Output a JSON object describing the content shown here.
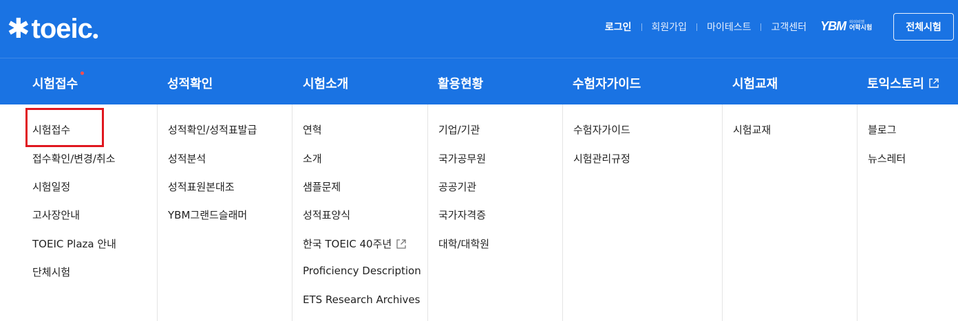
{
  "logo": {
    "text": "toeic",
    "icon": "asterisk-logo-icon"
  },
  "util_nav": [
    {
      "label": "로그인"
    },
    {
      "label": "회원가입"
    },
    {
      "label": "마이테스트"
    },
    {
      "label": "고객센터"
    }
  ],
  "partner_logo": {
    "mark": "YBM",
    "line1": "와이비엠",
    "line2": "어학시험"
  },
  "all_menu_button": "전체시험",
  "main_nav": [
    {
      "label": "시험접수"
    },
    {
      "label": "성적확인"
    },
    {
      "label": "시험소개"
    },
    {
      "label": "활용현황"
    },
    {
      "label": "수험자가이드"
    },
    {
      "label": "시험교재"
    },
    {
      "label": "토익스토리"
    }
  ],
  "submenus": [
    [
      "시험접수",
      "접수확인/변경/취소",
      "시험일정",
      "고사장안내",
      "TOEIC Plaza 안내",
      "단체시험"
    ],
    [
      "성적확인/성적표발급",
      "성적분석",
      "성적표원본대조",
      "YBM그랜드슬래머"
    ],
    [
      "연혁",
      "소개",
      "샘플문제",
      "성적표양식",
      "한국 TOEIC 40주년",
      "Proficiency Description",
      "ETS Research Archives"
    ],
    [
      "기업/기관",
      "국가공무원",
      "공공기관",
      "국가자격증",
      "대학/대학원"
    ],
    [
      "수험자가이드",
      "시험관리규정"
    ],
    [
      "시험교재"
    ],
    [
      "블로그",
      "뉴스레터"
    ]
  ],
  "colors": {
    "brand_blue": "#1a73e3",
    "highlight_red": "#e0171f",
    "new_dot": "#ff4d4d"
  }
}
